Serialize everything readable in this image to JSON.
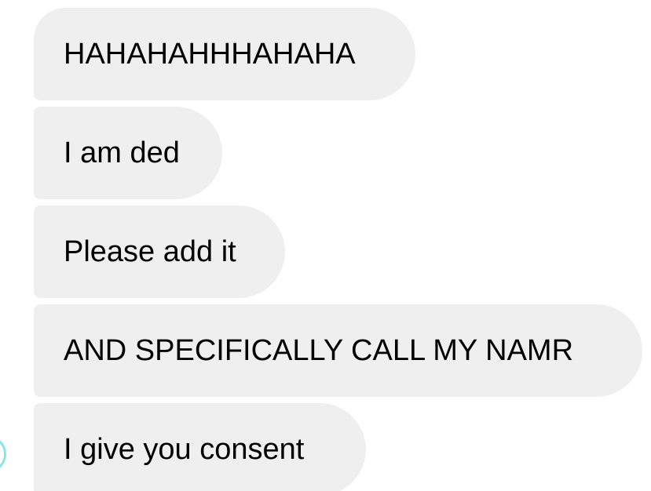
{
  "messages": [
    {
      "text": "HAHAHAHHHAHAHA"
    },
    {
      "text": "I am ded"
    },
    {
      "text": "Please add it"
    },
    {
      "text": "AND SPECIFICALLY CALL MY NAMR"
    },
    {
      "text": "I give you consent"
    }
  ],
  "colors": {
    "bubble_background": "#efefef",
    "text": "#000000",
    "avatar_ring": "#8fe1ea"
  }
}
